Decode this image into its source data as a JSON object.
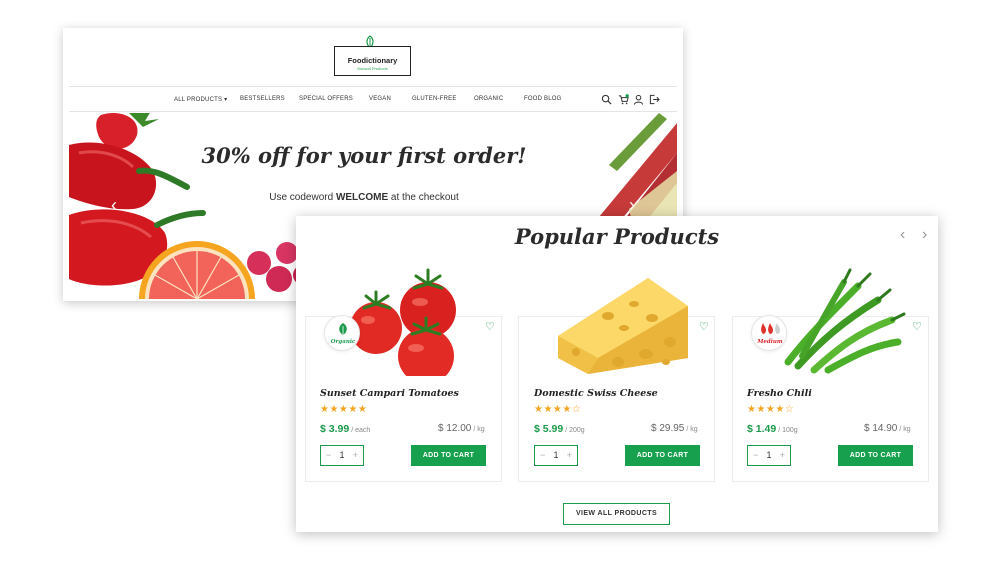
{
  "brand": {
    "name": "Foodictionary",
    "tagline": "Natural Products",
    "accent": "#17a04e"
  },
  "nav": {
    "items": [
      "ALL PRODUCTS",
      "BESTSELLERS",
      "SPECIAL OFFERS",
      "VEGAN",
      "GLUTEN-FREE",
      "ORGANIC",
      "FOOD BLOG"
    ],
    "dropdown_caret": "▾",
    "icons": [
      "search-icon",
      "cart-icon",
      "user-icon",
      "logout-icon"
    ]
  },
  "hero": {
    "title": "30% off  for your first order!",
    "subtitle_before": "Use codeword ",
    "code": "WELCOME",
    "subtitle_after": " at the checkout",
    "prev": "‹",
    "next": "›"
  },
  "popular": {
    "title": "Popular Products",
    "prev": "‹",
    "next": "›",
    "view_all": "VIEW ALL PRODUCTS",
    "add_to_cart": "ADD TO CART",
    "products": [
      {
        "name": "Sunset Campari Tomatoes",
        "rating": 5,
        "stars": "★★★★★",
        "price": "$ 3.99",
        "unit": "/ each",
        "alt_price": "$ 12.00",
        "alt_unit": "/ kg",
        "qty": "1",
        "badge": "Organic",
        "image": "tomatoes"
      },
      {
        "name": "Domestic Swiss Cheese",
        "rating": 4,
        "stars": "★★★★☆",
        "price": "$ 5.99",
        "unit": "/ 200g",
        "alt_price": "$ 29.95",
        "alt_unit": "/ kg",
        "qty": "1",
        "badge": "",
        "image": "cheese"
      },
      {
        "name": "Fresho Chili",
        "rating": 4,
        "stars": "★★★★☆",
        "price": "$ 1.49",
        "unit": "/ 100g",
        "alt_price": "$ 14.90",
        "alt_unit": "/ kg",
        "qty": "1",
        "badge": "Medium",
        "image": "chili"
      }
    ]
  },
  "qty_minus": "−",
  "qty_plus": "+",
  "heart": "♡"
}
